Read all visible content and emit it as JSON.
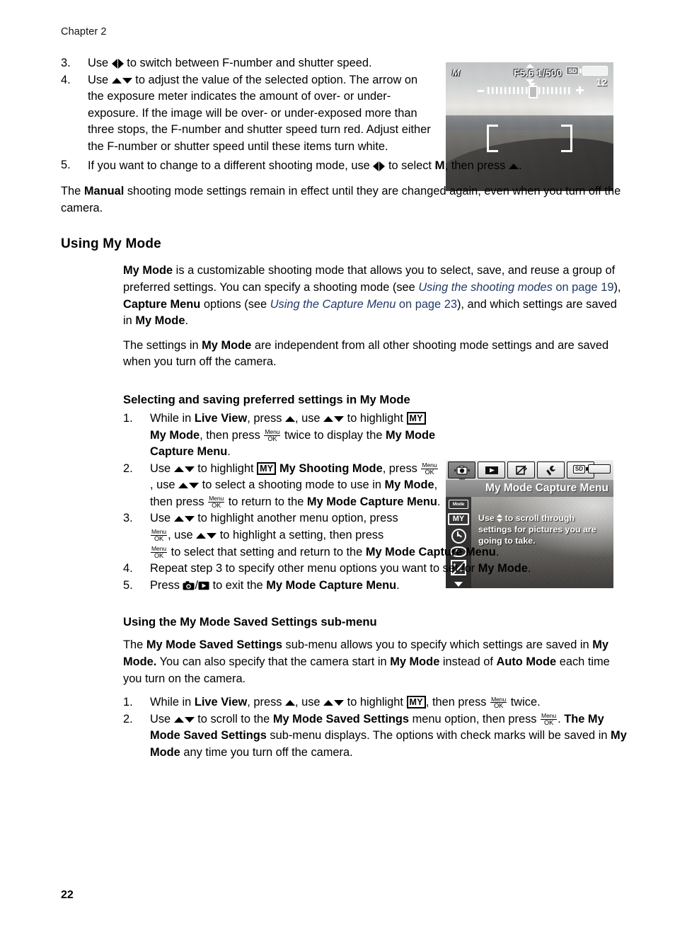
{
  "header": {
    "chapter": "Chapter 2"
  },
  "footer": {
    "page_number": "22"
  },
  "manual_steps": {
    "step3": {
      "num": "3.",
      "text_before": "Use",
      "text_after": "to switch between F-number and shutter speed."
    },
    "step4": {
      "num": "4.",
      "text_before": "Use",
      "text_after": "to adjust the value of the selected option. The arrow on the exposure meter indicates the amount of over- or under-exposure. If the image will be over- or under-exposed more than three stops, the F-number and shutter speed turn red. Adjust either the F-number or shutter speed until these items turn white."
    },
    "step5": {
      "num": "5.",
      "part1": "If you want to change to a different shooting mode, use",
      "part2": "to select",
      "mode_key": "M",
      "part3": ", then press",
      "part4": "."
    },
    "closing": {
      "t1": "The ",
      "b1": "Manual",
      "t2": " shooting mode settings remain in effect until they are changed again, even when you turn off the camera."
    }
  },
  "using_my_mode": {
    "heading": "Using My Mode",
    "para1": {
      "b1": "My Mode",
      "t1": " is a customizable shooting mode that allows you to select, save, and reuse a group of preferred settings. You can specify a shooting mode (see ",
      "link1": "Using the shooting modes",
      "t2": " on page 19",
      "t3": "), ",
      "b2": "Capture Menu",
      "t4": " options (see ",
      "link2": "Using the Capture Menu",
      "t5": " on page 23",
      "t6": "), and which settings are saved in ",
      "b3": "My Mode",
      "t7": "."
    },
    "para2": {
      "t1": "The settings in ",
      "b1": "My Mode",
      "t2": " are independent from all other shooting mode settings and are saved when you turn off the camera."
    }
  },
  "selecting_saving": {
    "heading": "Selecting and saving preferred settings in My Mode",
    "steps": [
      {
        "num": "1.",
        "p1": "While in ",
        "b1": "Live View",
        "p2": ", press ",
        "p3": ", use ",
        "p4": " to highlight ",
        "my_key": "MY",
        "b2": " My Mode",
        "p5": ", then press ",
        "p6": " twice to display the ",
        "b3": "My Mode Capture Menu",
        "p7": "."
      },
      {
        "num": "2.",
        "p1": "Use ",
        "p2": " to highlight ",
        "my_key": "MY",
        "b1": " My Shooting Mode",
        "p3": ", press ",
        "p4": ", use ",
        "p5": " to select a shooting mode to use in ",
        "b2": "My Mode",
        "p6": ", then press ",
        "p7": " to return to the ",
        "b3": "My Mode Capture Menu",
        "p8": "."
      },
      {
        "num": "3.",
        "p1": "Use ",
        "p2": " to highlight another menu option, press ",
        "p3": ", use ",
        "p4": " to highlight a setting, then press ",
        "p5": " to select that setting and return to the ",
        "b1": "My Mode Capture Menu",
        "p6": "."
      },
      {
        "num": "4.",
        "p1": "Repeat step 3 to specify other menu options you want to set for ",
        "b1": "My Mode",
        "p2": "."
      },
      {
        "num": "5.",
        "p1": "Press ",
        "p2": " to exit the ",
        "b1": "My Mode Capture Menu",
        "p3": "."
      }
    ]
  },
  "saved_settings": {
    "heading": "Using the My Mode Saved Settings sub-menu",
    "intro": {
      "t1": "The ",
      "b1": "My Mode Saved Settings",
      "t2": " sub-menu allows you to specify which settings are saved in ",
      "b2": "My Mode.",
      "t3": " You can also specify that the camera start in ",
      "b3": "My Mode",
      "t4": " instead of ",
      "b4": "Auto Mode",
      "t5": " each time you turn on the camera."
    },
    "steps": [
      {
        "num": "1.",
        "p1": "While in ",
        "b1": "Live View",
        "p2": ", press ",
        "p3": ", use ",
        "p4": " to highlight ",
        "my_key": "MY",
        "p5": ", then press ",
        "p6": " twice."
      },
      {
        "num": "2.",
        "p1": "Use ",
        "p2": " to scroll to the ",
        "b1": "My Mode Saved Settings",
        "p3": " menu option, then press ",
        "p4": ". ",
        "b2": "The My Mode Saved Settings",
        "p5": " sub-menu displays. The options with check marks will be saved in ",
        "b3": "My Mode",
        "p6": " any time you turn off the camera."
      }
    ]
  },
  "screenshot_manual_lcd": {
    "mode_indicator": "M",
    "aperture": "F5.6",
    "shutter_speed": "1/500",
    "card_label": "SD",
    "frames_remaining": "12"
  },
  "screenshot_mymode_menu": {
    "title": "My Mode Capture Menu",
    "card_label": "SD",
    "help_text_1": "Use",
    "help_text_2": "to scroll through settings for pictures you are going to take.",
    "sidebar_icons": [
      {
        "name": "mode-icon",
        "label": "Mode"
      },
      {
        "name": "my-mode-icon",
        "label": "MY"
      },
      {
        "name": "self-timer-icon",
        "label": ""
      },
      {
        "name": "red-eye-icon",
        "label": ""
      },
      {
        "name": "exposure-compensation-icon",
        "label": ""
      },
      {
        "name": "scroll-down-chevron-icon",
        "label": ""
      }
    ],
    "tabs": [
      {
        "name": "capture-tab",
        "active": true
      },
      {
        "name": "playback-tab",
        "active": false
      },
      {
        "name": "design-gallery-tab",
        "active": false
      },
      {
        "name": "setup-tab",
        "active": false
      },
      {
        "name": "help-tab",
        "active": false
      }
    ]
  },
  "key_glyphs": {
    "menu_top": "Menu",
    "menu_bottom": "OK"
  },
  "colors": {
    "link": "#1F3A6E",
    "text": "#000000",
    "page_bg": "#FFFFFF"
  }
}
